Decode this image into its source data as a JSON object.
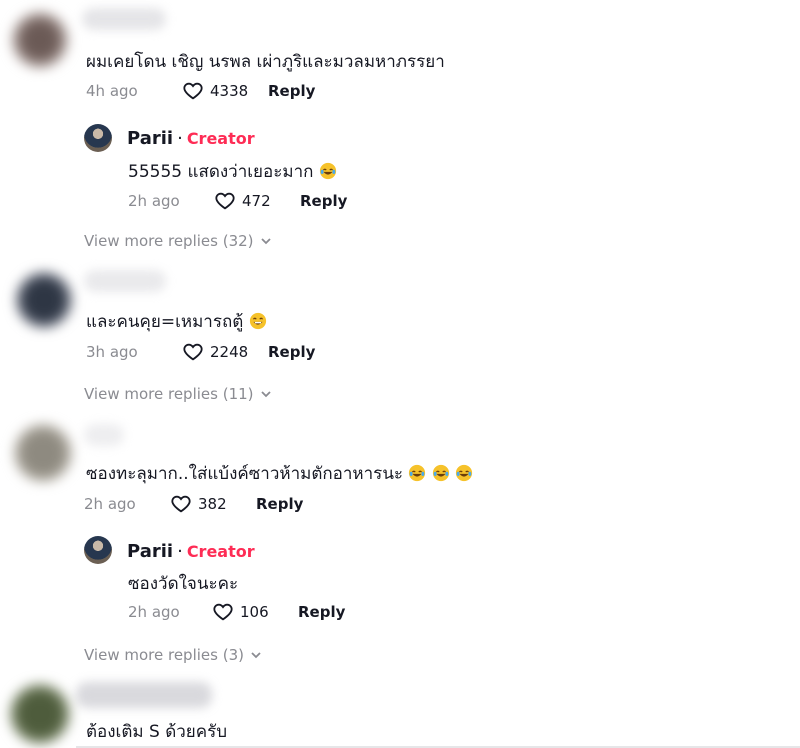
{
  "comments": [
    {
      "text": "ผมเคยโดน เชิญ นรพล เผ่าภูริและมวลมหาภรรยา",
      "time": "4h ago",
      "likes": "4338",
      "reply": "Reply"
    },
    {
      "text": "และคนคุย=เหมารถตู้",
      "time": "3h ago",
      "likes": "2248",
      "reply": "Reply"
    },
    {
      "text": "ซองทะลุมาก..ใส่แบ้งค์ซาวห้ามตักอาหารนะ",
      "time": "2h ago",
      "likes": "382",
      "reply": "Reply"
    },
    {
      "text": "ต้องเติม S ด้วยครับ"
    }
  ],
  "replies": [
    {
      "name": "Parii",
      "dot": "·",
      "badge": "Creator",
      "text": "55555 แสดงว่าเยอะมาก",
      "time": "2h ago",
      "likes": "472",
      "reply": "Reply"
    },
    {
      "name": "Parii",
      "dot": "·",
      "badge": "Creator",
      "text": "ซองวัดใจนะคะ",
      "time": "2h ago",
      "likes": "106",
      "reply": "Reply"
    }
  ],
  "more_replies": [
    {
      "label": "View more replies (32)"
    },
    {
      "label": "View more replies (11)"
    },
    {
      "label": "View more replies (3)"
    }
  ],
  "icons": {
    "like": "heart-outline-icon",
    "more": "chevron-down-icon",
    "emoji": "laughing-tears-emoji-icon"
  },
  "colors": {
    "creator": "#fe2c55",
    "muted": "#8a8b91",
    "text": "#161823"
  }
}
